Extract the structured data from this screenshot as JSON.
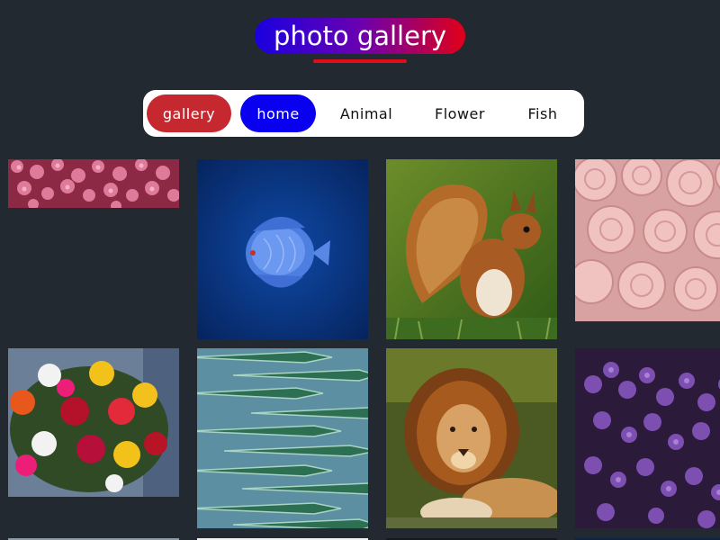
{
  "header": {
    "title": "photo gallery"
  },
  "filters": [
    {
      "label": "gallery",
      "selected": true
    },
    {
      "label": "home",
      "selected": false
    },
    {
      "label": "Animal",
      "selected": false
    },
    {
      "label": "Flower",
      "selected": false
    },
    {
      "label": "Fish",
      "selected": false
    }
  ],
  "photos": [
    {
      "subject": "pink-flowers"
    },
    {
      "subject": "blue-discus-fish"
    },
    {
      "subject": "red-squirrel"
    },
    {
      "subject": "pink-roses"
    },
    {
      "subject": "flower-bouquet"
    },
    {
      "subject": "barracuda-school"
    },
    {
      "subject": "lion"
    },
    {
      "subject": "purple-lilac"
    }
  ],
  "colors": {
    "background": "#232931",
    "gallery_button": "#c6282f",
    "home_button": "#0a00f0",
    "title_gradient_start": "#1a00e0",
    "title_gradient_end": "#e00018",
    "underline": "#e00d1c"
  }
}
